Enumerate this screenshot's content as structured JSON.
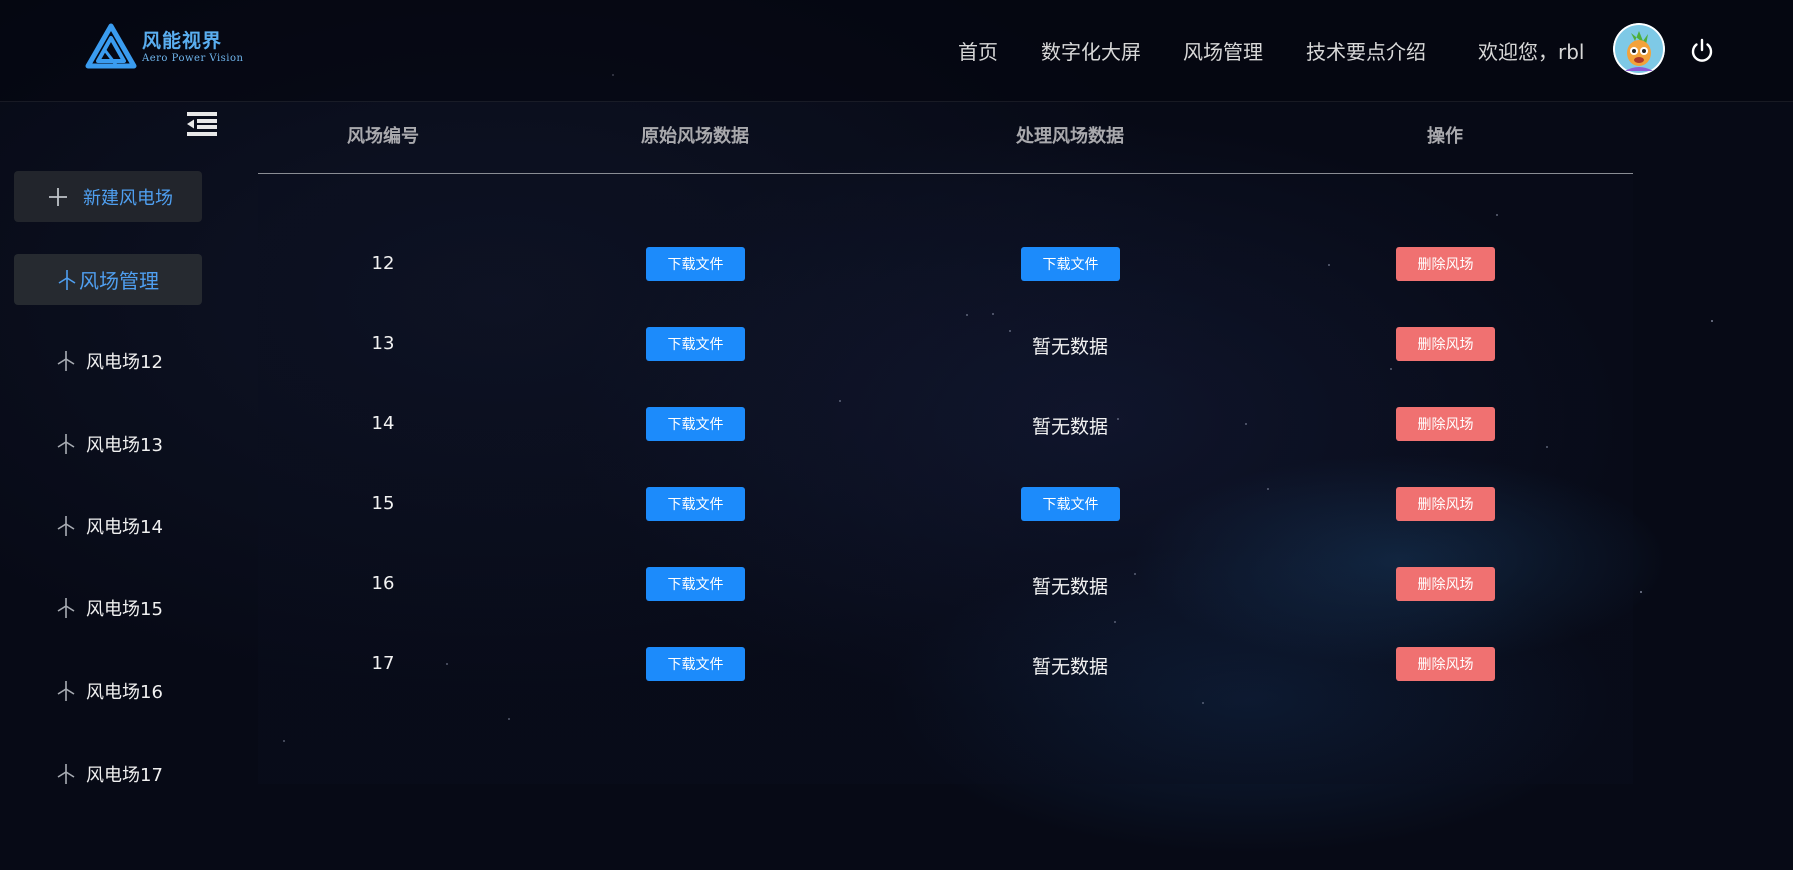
{
  "header": {
    "logo_cn": "风能视界",
    "logo_en": "Aero Power Vision",
    "nav": [
      "首页",
      "数字化大屏",
      "风场管理",
      "技术要点介绍"
    ],
    "welcome": "欢迎您，rbl"
  },
  "sidebar": {
    "new_button": "新建风电场",
    "active_item": "风场管理",
    "items": [
      "风电场12",
      "风电场13",
      "风电场14",
      "风电场15",
      "风电场16",
      "风电场17"
    ]
  },
  "table": {
    "headers": [
      "风场编号",
      "原始风场数据",
      "处理风场数据",
      "操作"
    ],
    "download_label": "下载文件",
    "no_data_label": "暂无数据",
    "delete_label": "删除风场",
    "rows": [
      {
        "id": "12",
        "raw": "下载文件",
        "processed": "下载文件",
        "action": "删除风场"
      },
      {
        "id": "13",
        "raw": "下载文件",
        "processed": "暂无数据",
        "action": "删除风场"
      },
      {
        "id": "14",
        "raw": "下载文件",
        "processed": "暂无数据",
        "action": "删除风场"
      },
      {
        "id": "15",
        "raw": "下载文件",
        "processed": "下载文件",
        "action": "删除风场"
      },
      {
        "id": "16",
        "raw": "下载文件",
        "processed": "暂无数据",
        "action": "删除风场"
      },
      {
        "id": "17",
        "raw": "下载文件",
        "processed": "暂无数据",
        "action": "删除风场"
      }
    ]
  },
  "colors": {
    "accent_blue": "#1c8bfb",
    "danger_red": "#f07171",
    "link_blue": "#4f9ff0"
  },
  "icons": {
    "logo": "triangle-logo-icon",
    "collapse": "menu-collapse-icon",
    "new": "plus-icon",
    "turbine": "wind-turbine-icon",
    "power": "power-icon",
    "avatar": "user-avatar"
  }
}
